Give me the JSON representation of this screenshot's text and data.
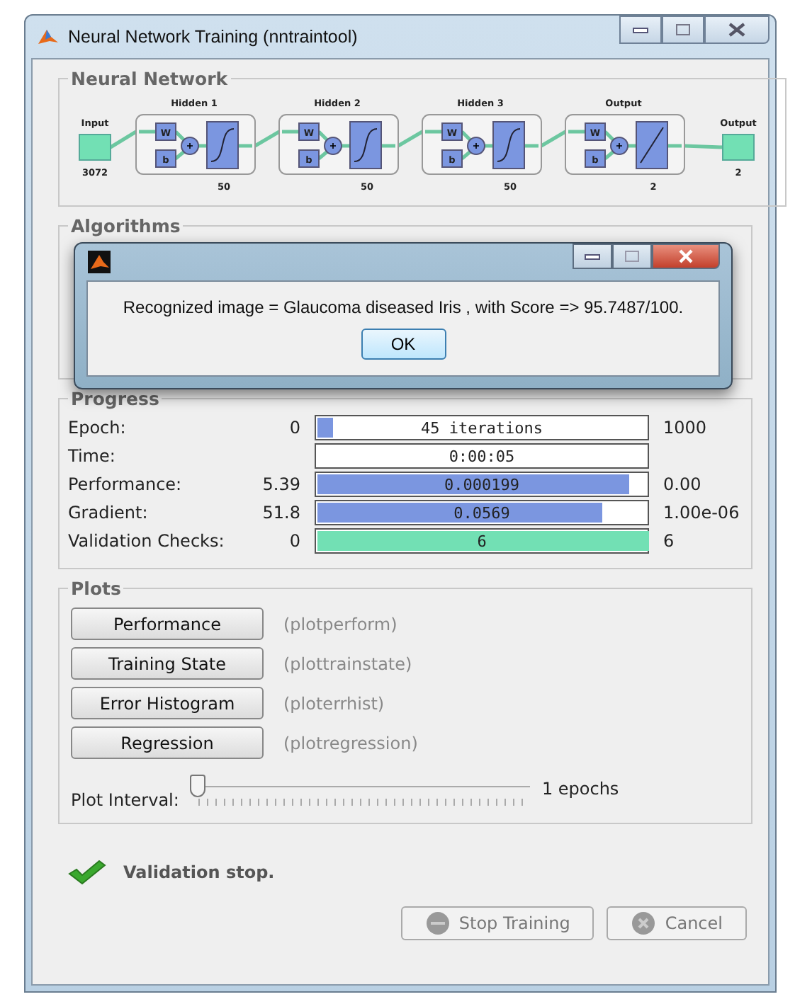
{
  "window": {
    "title": "Neural Network Training (nntraintool)"
  },
  "network": {
    "title": "Neural Network",
    "input": {
      "label": "Input",
      "size": "3072"
    },
    "layers": [
      {
        "title": "Hidden 1",
        "size": "50",
        "weight": "W",
        "bias": "b",
        "kind": "sigmoid"
      },
      {
        "title": "Hidden 2",
        "size": "50",
        "weight": "W",
        "bias": "b",
        "kind": "sigmoid"
      },
      {
        "title": "Hidden 3",
        "size": "50",
        "weight": "W",
        "bias": "b",
        "kind": "sigmoid"
      },
      {
        "title": "Output",
        "size": "2",
        "weight": "W",
        "bias": "b",
        "kind": "linear"
      }
    ],
    "output": {
      "label": "Output",
      "size": "2"
    }
  },
  "algorithms": {
    "title": "Algorithms"
  },
  "dialog": {
    "message": "Recognized image = Glaucoma diseased Iris , with Score => 95.7487/100.",
    "button": "OK"
  },
  "progress": {
    "title": "Progress",
    "rows": [
      {
        "label": "Epoch:",
        "start": "0",
        "value": "45 iterations",
        "level": 0.045,
        "end": "1000",
        "color": "#7b96e0"
      },
      {
        "label": "Time:",
        "value": "0:00:05"
      },
      {
        "label": "Performance:",
        "start": "5.39",
        "value": "0.000199",
        "level": 0.94,
        "end": "0.00",
        "color": "#7b96e0"
      },
      {
        "label": "Gradient:",
        "start": "51.8",
        "value": "0.0569",
        "level": 0.86,
        "end": "1.00e-06",
        "color": "#7b96e0"
      },
      {
        "label": "Validation Checks:",
        "start": "0",
        "value": "6",
        "level": 1,
        "end": "6",
        "color": "#72e0b4"
      }
    ]
  },
  "plots": {
    "title": "Plots",
    "items": [
      {
        "button": "Performance",
        "function": "(plotperform)"
      },
      {
        "button": "Training State",
        "function": "(plottrainstate)"
      },
      {
        "button": "Error Histogram",
        "function": "(ploterrhist)"
      },
      {
        "button": "Regression",
        "function": "(plotregression)"
      }
    ],
    "interval": {
      "label": "Plot Interval:",
      "level": 0,
      "reading": "1 epochs"
    }
  },
  "status": {
    "text": "Validation stop.",
    "done": true
  },
  "buttons": [
    {
      "label": "Stop Training",
      "kind": "stop",
      "disabled": true
    },
    {
      "label": "Cancel",
      "kind": "cancel",
      "disabled": true
    }
  ]
}
